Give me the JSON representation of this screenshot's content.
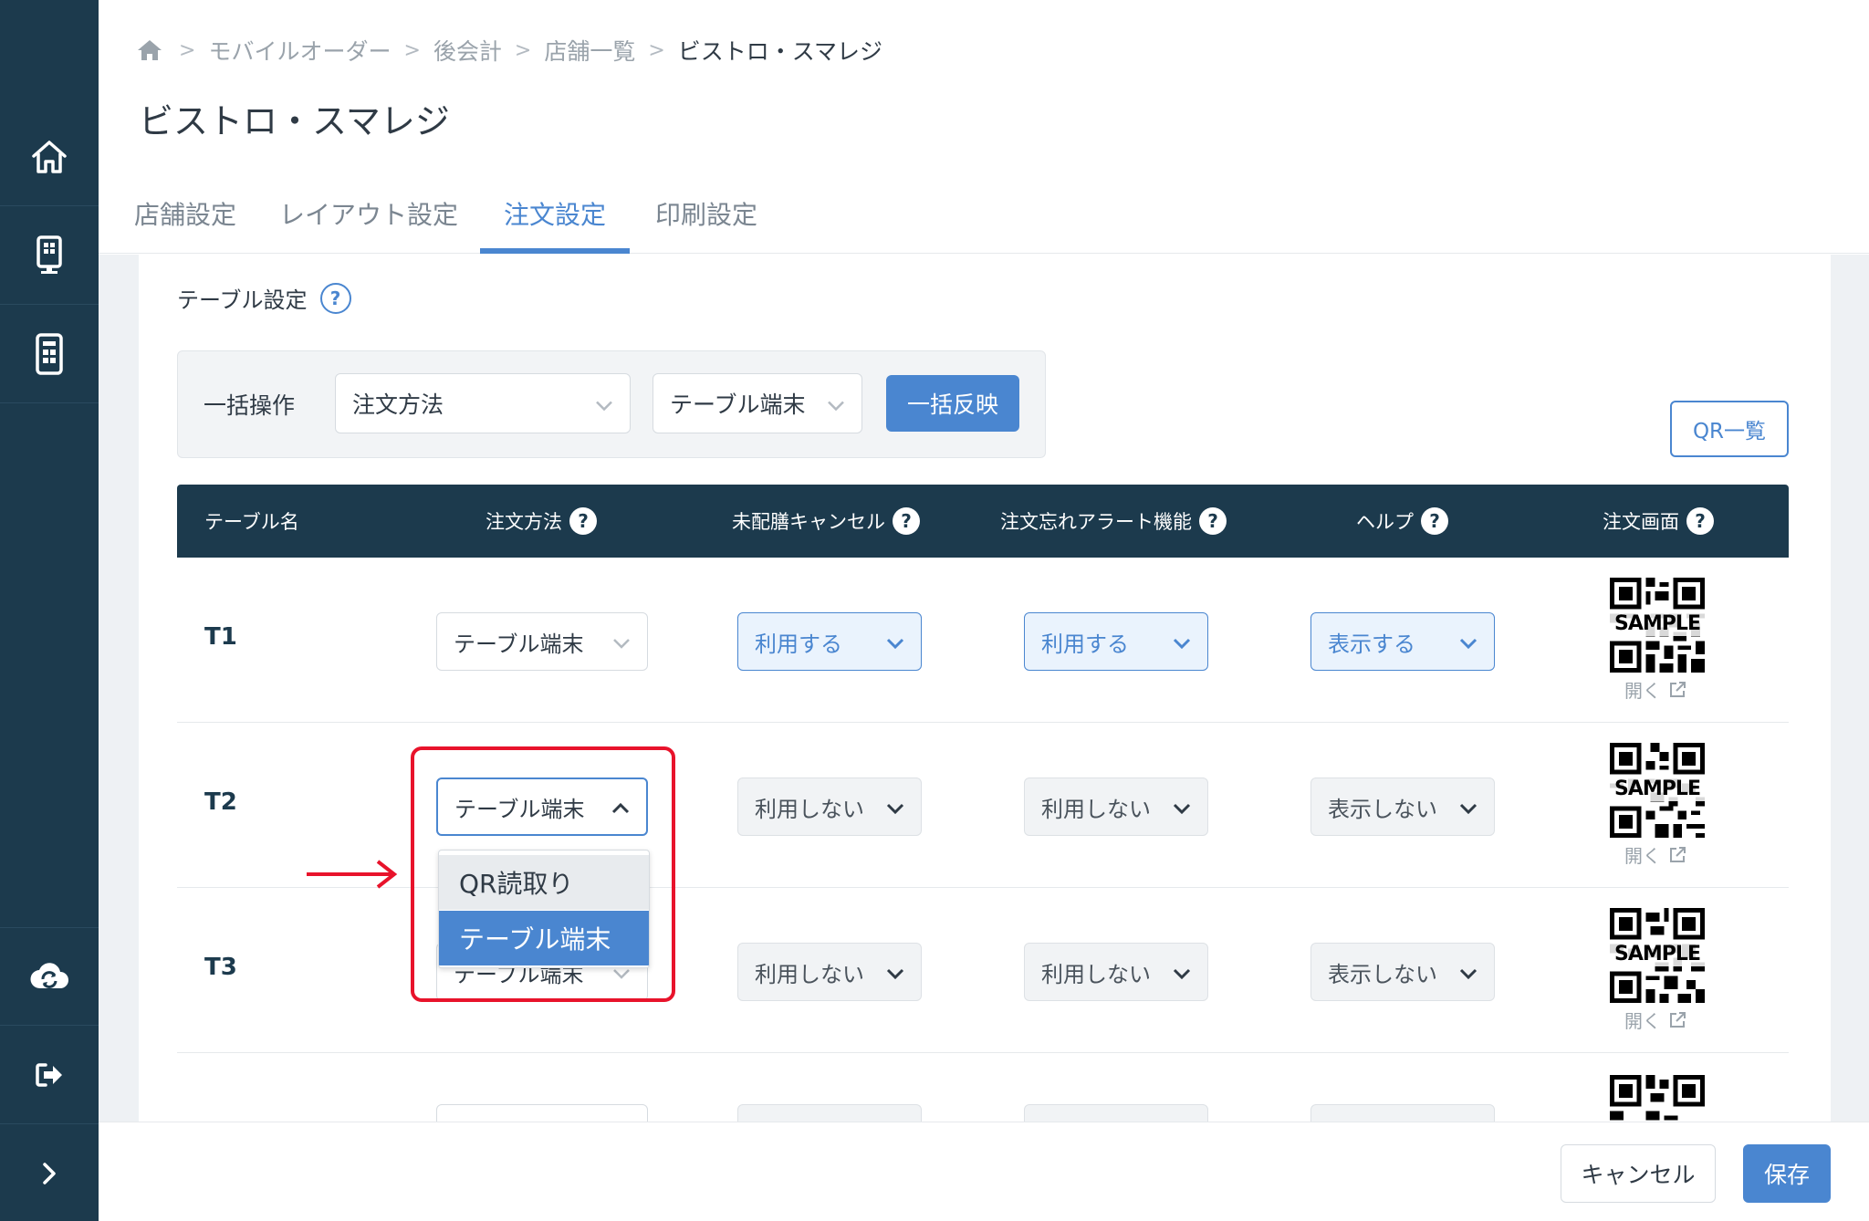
{
  "colors": {
    "sidebar": "#1c3a4d",
    "accent": "#4a86d0",
    "highlight": "#e8132b",
    "table_header": "#1c3a4d"
  },
  "sidebar": {
    "items": [
      {
        "icon": "home-icon"
      },
      {
        "icon": "kiosk-icon"
      },
      {
        "icon": "tablet-icon"
      },
      {
        "icon": "cloud-sync-icon"
      },
      {
        "icon": "logout-icon"
      },
      {
        "icon": "chevron-right-icon"
      }
    ]
  },
  "breadcrumb": {
    "items": [
      "モバイルオーダー",
      "後会計",
      "店舗一覧"
    ],
    "current": "ビストロ・スマレジ"
  },
  "page": {
    "title": "ビストロ・スマレジ"
  },
  "tabs": [
    {
      "label": "店舗設定",
      "active": false
    },
    {
      "label": "レイアウト設定",
      "active": false
    },
    {
      "label": "注文設定",
      "active": true
    },
    {
      "label": "印刷設定",
      "active": false
    }
  ],
  "section": {
    "title": "テーブル設定",
    "help": "?"
  },
  "bulk": {
    "label": "一括操作",
    "select1": "注文方法",
    "select2": "テーブル端末",
    "apply_button": "一括反映"
  },
  "qr_list_button": "QR一覧",
  "table": {
    "headers": [
      "テーブル名",
      "注文方法",
      "未配膳キャンセル",
      "注文忘れアラート機能",
      "ヘルプ",
      "注文画面"
    ],
    "help": "?",
    "qr_sample": "SAMPLE",
    "open_label": "開く",
    "rows": [
      {
        "name": "T1",
        "order_method": "テーブル端末",
        "cancel": "利用する",
        "alert": "利用する",
        "help": "表示する"
      },
      {
        "name": "T2",
        "order_method": "テーブル端末",
        "cancel": "利用しない",
        "alert": "利用しない",
        "help": "表示しない"
      },
      {
        "name": "T3",
        "order_method": "テーブル端末",
        "cancel": "利用しない",
        "alert": "利用しない",
        "help": "表示しない"
      }
    ]
  },
  "dropdown": {
    "options": [
      "QR読取り",
      "テーブル端末"
    ],
    "selected": "テーブル端末"
  },
  "footer": {
    "cancel": "キャンセル",
    "save": "保存"
  }
}
